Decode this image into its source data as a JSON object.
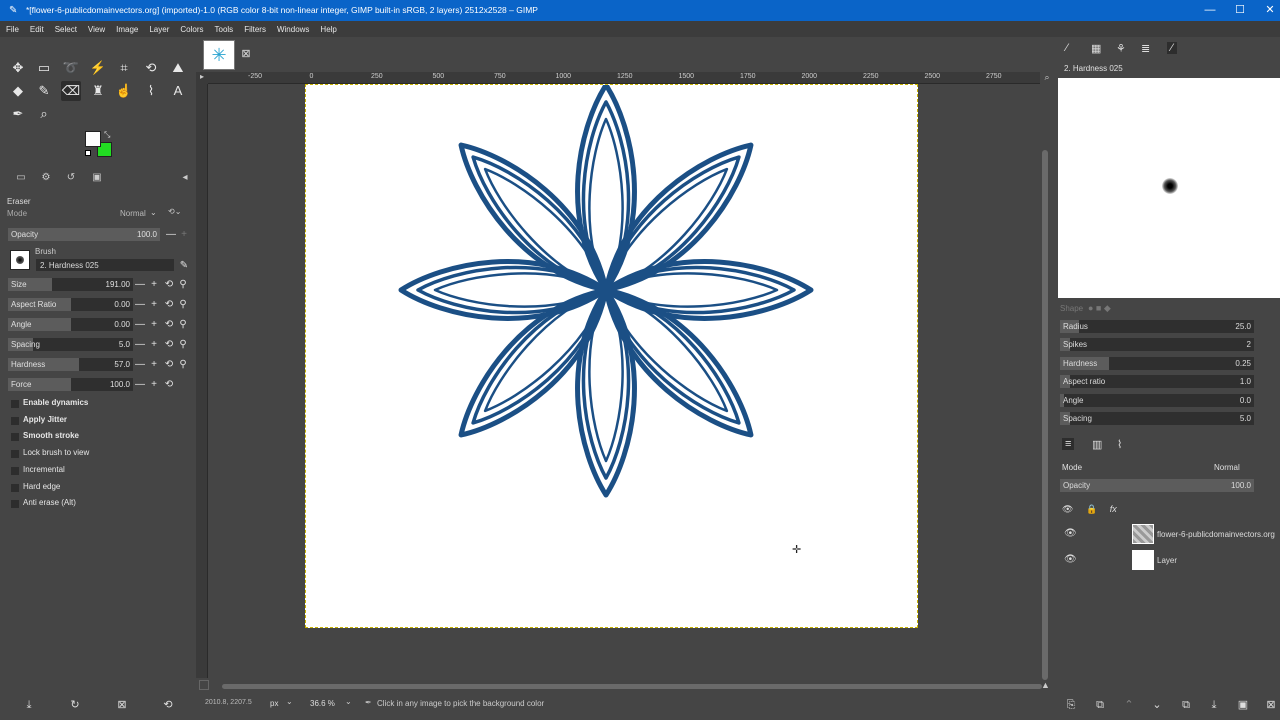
{
  "window": {
    "title": "*[flower-6-publicdomainvectors.org] (imported)-1.0 (RGB color 8-bit non-linear integer, GIMP built-in sRGB, 2 layers) 2512x2528 – GIMP",
    "minimize": "—",
    "maximize": "☐",
    "close": "✕"
  },
  "menu": [
    "File",
    "Edit",
    "Select",
    "View",
    "Image",
    "Layer",
    "Colors",
    "Tools",
    "Filters",
    "Windows",
    "Help"
  ],
  "colors": {
    "foreground": "#ffffff",
    "background": "#22dd22",
    "accent": "#0a64c8"
  },
  "tool_options": {
    "title": "Eraser",
    "mode_label": "Mode",
    "mode_value": "Normal",
    "opacity": {
      "label": "Opacity",
      "value": "100.0",
      "fraction": 1.0
    },
    "brush_label": "Brush",
    "brush_name": "2. Hardness 025",
    "sliders": [
      {
        "label": "Size",
        "value": "191.00",
        "fraction": 0.35
      },
      {
        "label": "Aspect Ratio",
        "value": "0.00",
        "fraction": 0.5
      },
      {
        "label": "Angle",
        "value": "0.00",
        "fraction": 0.5
      },
      {
        "label": "Spacing",
        "value": "5.0",
        "fraction": 0.2
      },
      {
        "label": "Hardness",
        "value": "57.0",
        "fraction": 0.57
      },
      {
        "label": "Force",
        "value": "100.0",
        "fraction": 0.5
      }
    ],
    "checkboxes": [
      {
        "label": "Enable dynamics",
        "bold": true
      },
      {
        "label": "Apply Jitter",
        "bold": true
      },
      {
        "label": "Smooth stroke",
        "bold": true
      },
      {
        "label": "Lock brush to view",
        "bold": false
      },
      {
        "label": "Incremental",
        "bold": false
      },
      {
        "label": "Hard edge",
        "bold": false
      },
      {
        "label": "Anti erase  (Alt)",
        "bold": false
      }
    ]
  },
  "rulers": {
    "h_ticks": [
      "-250",
      "0",
      "250",
      "500",
      "750",
      "1000",
      "1250",
      "1500",
      "1750",
      "2000",
      "2250",
      "2500",
      "2750"
    ]
  },
  "status": {
    "coords": "2010.8, 2207.5",
    "unit": "px",
    "zoom": "36.6 %",
    "message": "Click in any image to pick the background color"
  },
  "brush_panel": {
    "brush_name": "2. Hardness 025",
    "shape_label": "Shape",
    "params": [
      {
        "label": "Radius",
        "value": "25.0",
        "fraction": 0.1
      },
      {
        "label": "Spikes",
        "value": "2",
        "fraction": 0.05
      },
      {
        "label": "Hardness",
        "value": "0.25",
        "fraction": 0.25
      },
      {
        "label": "Aspect ratio",
        "value": "1.0",
        "fraction": 0.05
      },
      {
        "label": "Angle",
        "value": "0.0",
        "fraction": 0.02
      },
      {
        "label": "Spacing",
        "value": "5.0",
        "fraction": 0.05
      }
    ]
  },
  "layers_panel": {
    "mode_label": "Mode",
    "mode_value": "Normal",
    "opacity_label": "Opacity",
    "opacity_value": "100.0",
    "layers": [
      {
        "name": "flower-6-publicdomainvectors.org"
      },
      {
        "name": "Layer"
      }
    ]
  }
}
